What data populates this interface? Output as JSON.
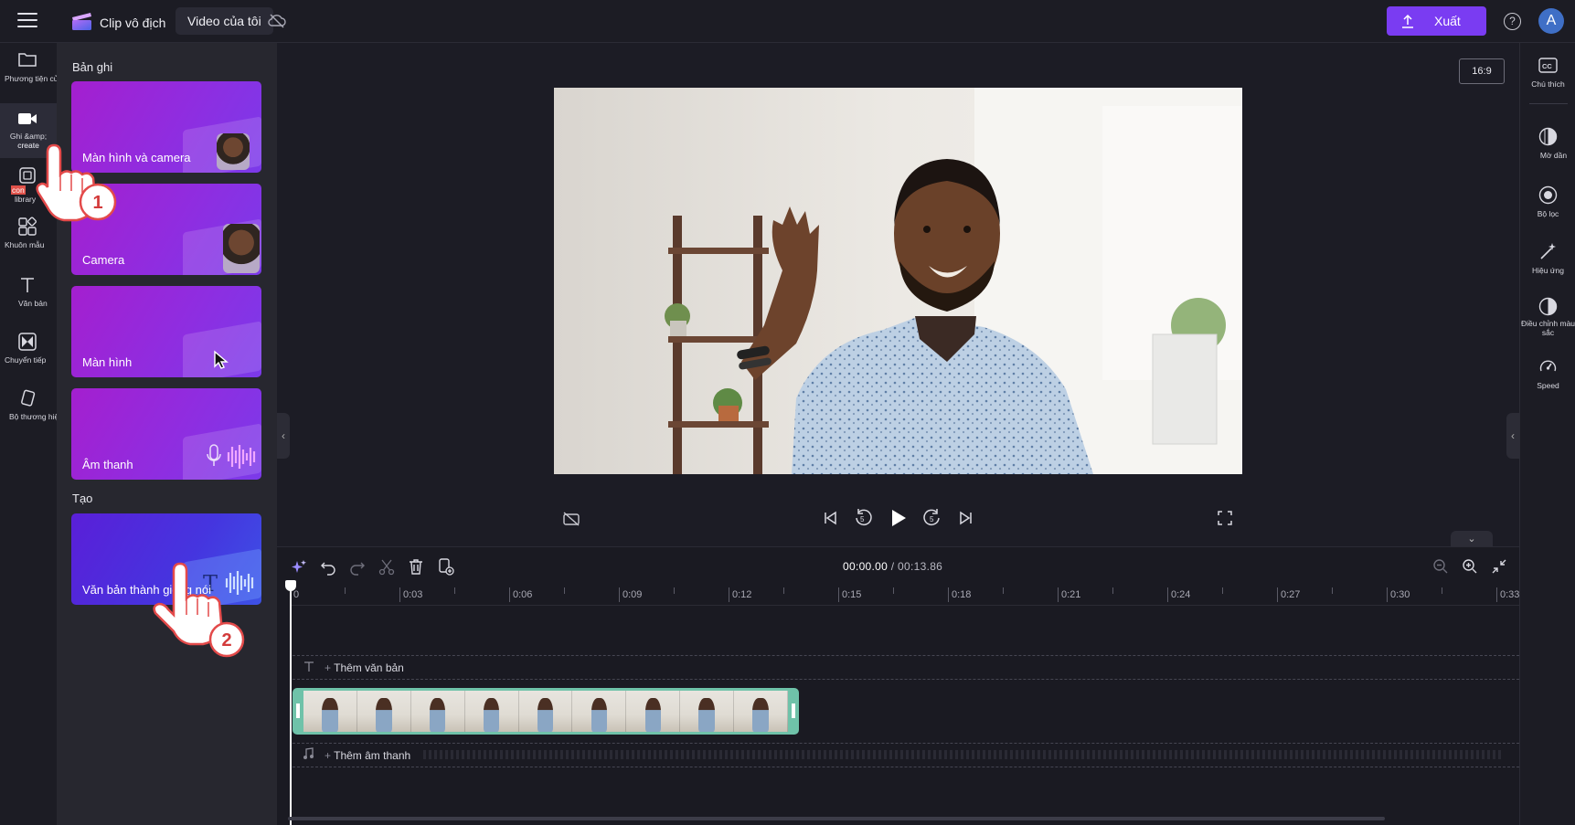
{
  "header": {
    "app_title": "Clip vô địch",
    "tab_label": "Video của tôi",
    "export_label": "Xuất",
    "help_glyph": "?",
    "avatar_initial": "A",
    "accent_color": "#7a3cf2"
  },
  "left_nav": {
    "items": [
      {
        "label": "Phương tiện của bạn",
        "icon": "folder-icon"
      },
      {
        "label": "Ghi &amp; create",
        "icon": "video-camera-icon",
        "active": true
      },
      {
        "label": "library",
        "icon": "content-library-icon",
        "highlight": "con"
      },
      {
        "label": "Khuôn mẫu",
        "icon": "templates-icon"
      },
      {
        "label": "Văn bản",
        "icon": "text-icon"
      },
      {
        "label": "Chuyển tiếp",
        "icon": "transitions-icon"
      },
      {
        "label": "Bộ thương hiệu",
        "icon": "brand-kit-icon"
      }
    ]
  },
  "panel": {
    "record_heading": "Bản ghi",
    "create_heading": "Tạo",
    "cards": [
      {
        "label": "Màn hình và camera"
      },
      {
        "label": "Camera"
      },
      {
        "label": "Màn hình"
      },
      {
        "label": "Âm thanh"
      }
    ],
    "tts_card": {
      "label": "Văn bản thành giọng nói"
    }
  },
  "preview": {
    "aspect_ratio": "16:9"
  },
  "timeline": {
    "current_time": "00:00.00",
    "total_time": "/ 00:13.86",
    "ticks": [
      "0",
      "0:03",
      "0:06",
      "0:09",
      "0:12",
      "0:15",
      "0:18",
      "0:21",
      "0:24",
      "0:27",
      "0:30",
      "0:33"
    ],
    "add_text_label": "Thêm văn bản",
    "add_audio_label": "Thêm âm thanh"
  },
  "right_nav": {
    "items": [
      {
        "label": "Chú thích",
        "icon": "captions-icon"
      },
      {
        "label": "Mờ dần",
        "icon": "fade-icon"
      },
      {
        "label": "Bộ lọc",
        "icon": "filters-icon"
      },
      {
        "label": "Hiệu ứng",
        "icon": "effects-icon"
      },
      {
        "label": "Điều chỉnh màu sắc",
        "icon": "color-adjust-icon"
      },
      {
        "label": "Speed",
        "icon": "speed-icon"
      }
    ]
  },
  "annotations": {
    "step1": "1",
    "step2": "2"
  }
}
